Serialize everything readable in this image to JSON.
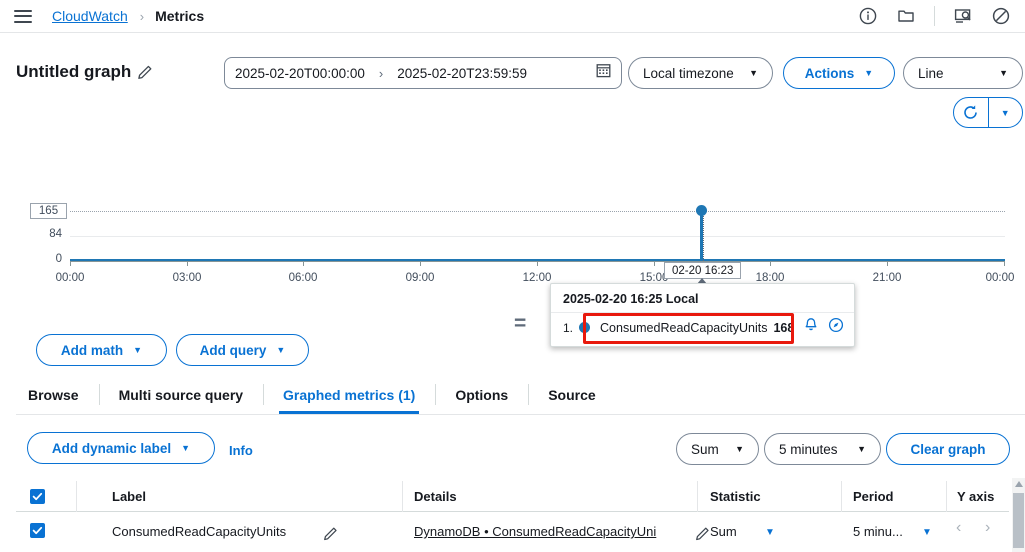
{
  "header": {
    "menu_icon": "hamburger-icon",
    "breadcrumb_root": "CloudWatch",
    "breadcrumb_sep": "›",
    "breadcrumb_current": "Metrics",
    "icons": [
      "info-icon",
      "folder-icon",
      "screen-search-icon",
      "no-entry-icon"
    ]
  },
  "toolbar": {
    "graph_title": "Untitled graph",
    "edit_icon": "pencil-icon",
    "start_time": "2025-02-20T00:00:00",
    "range_arrow": "›",
    "end_time": "2025-02-20T23:59:59",
    "calendar_icon": "calendar-icon",
    "timezone_label": "Local timezone",
    "actions_label": "Actions",
    "chart_type_label": "Line",
    "caret": "▼",
    "refresh_icon": "refresh-icon",
    "refresh_caret": "▼"
  },
  "chart_data": {
    "type": "line",
    "title": "Untitled graph",
    "xlabel": "",
    "ylabel": "",
    "ylim": [
      0,
      165
    ],
    "ytick_labels": [
      "165",
      "84",
      "0"
    ],
    "ytick_values": [
      165,
      84,
      0
    ],
    "xtick_labels": [
      "00:00",
      "03:00",
      "06:00",
      "09:00",
      "12:00",
      "15:00",
      "18:00",
      "21:00",
      "00:00"
    ],
    "grid": true,
    "legend": "none",
    "series": [
      {
        "name": "ConsumedReadCapacityUnits",
        "color": "#1f77b4",
        "baseline_value": 0,
        "peak": {
          "time": "16:23",
          "value": 168
        }
      }
    ],
    "cursor_label": "02-20 16:23",
    "annotation_marker": "="
  },
  "tooltip": {
    "timestamp": "2025-02-20 16:25 Local",
    "rows": [
      {
        "index": "1.",
        "color": "#1f77b4",
        "name": "ConsumedReadCapacityUnits",
        "value": "168"
      }
    ],
    "alarm_icon": "bell-icon",
    "explore_icon": "compass-icon",
    "highlight_color": "#e8190d"
  },
  "query_buttons": {
    "add_math": "Add math",
    "add_query": "Add query",
    "caret": "▼"
  },
  "tabs": [
    {
      "label": "Browse",
      "active": false
    },
    {
      "label": "Multi source query",
      "active": false
    },
    {
      "label": "Graphed metrics (1)",
      "active": true
    },
    {
      "label": "Options",
      "active": false
    },
    {
      "label": "Source",
      "active": false
    }
  ],
  "controls": {
    "dynamic_label": "Add dynamic label",
    "caret": "▼",
    "info": "Info",
    "statistic": "Sum",
    "period": "5 minutes",
    "clear_graph": "Clear graph"
  },
  "table": {
    "headers": [
      "Label",
      "Details",
      "Statistic",
      "Period",
      "Y axis"
    ],
    "rows": [
      {
        "selected": true,
        "color": "#1f77b4",
        "label": "ConsumedReadCapacityUnits",
        "label_edit_icon": "pencil-icon",
        "details": "DynamoDB • ConsumedReadCapacityUni",
        "details_edit_icon": "pencil-icon",
        "statistic": "Sum",
        "period": "5 minu...",
        "y_axis_left": "‹",
        "y_axis_right": "›",
        "caret": "▼"
      }
    ]
  }
}
